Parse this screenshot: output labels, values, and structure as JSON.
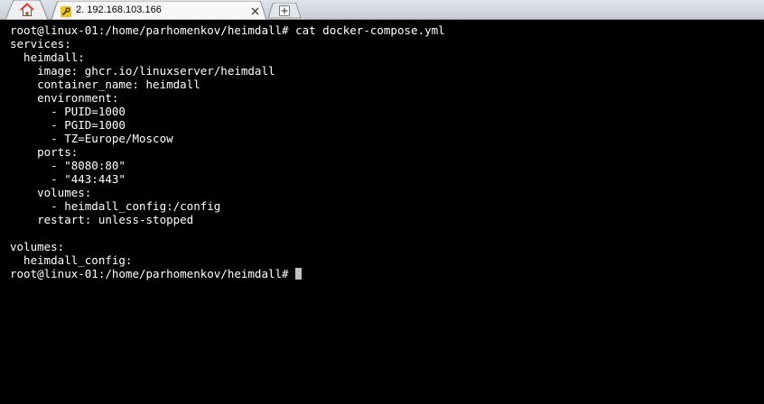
{
  "window": {
    "tab_title": "2. 192.168.103.166",
    "colors": {
      "terminal_background": "#000000",
      "terminal_text": "#ffffff",
      "tabbar_background": "#d4d8df",
      "home_icon_accent": "#e5352c"
    }
  },
  "tabs": {
    "home_icon": "home-icon",
    "session_icon": "wrench-icon",
    "close_icon": "close-icon",
    "new_tab_icon": "plus-icon"
  },
  "terminal": {
    "lines": [
      "root@linux-01:/home/parhomenkov/heimdall# cat docker-compose.yml",
      "services:",
      "  heimdall:",
      "    image: ghcr.io/linuxserver/heimdall",
      "    container_name: heimdall",
      "    environment:",
      "      - PUID=1000",
      "      - PGID=1000",
      "      - TZ=Europe/Moscow",
      "    ports:",
      "      - \"8080:80\"",
      "      - \"443:443\"",
      "    volumes:",
      "      - heimdall_config:/config",
      "    restart: unless-stopped",
      "",
      "volumes:",
      "  heimdall_config:"
    ],
    "prompt": "root@linux-01:/home/parhomenkov/heimdall# "
  }
}
